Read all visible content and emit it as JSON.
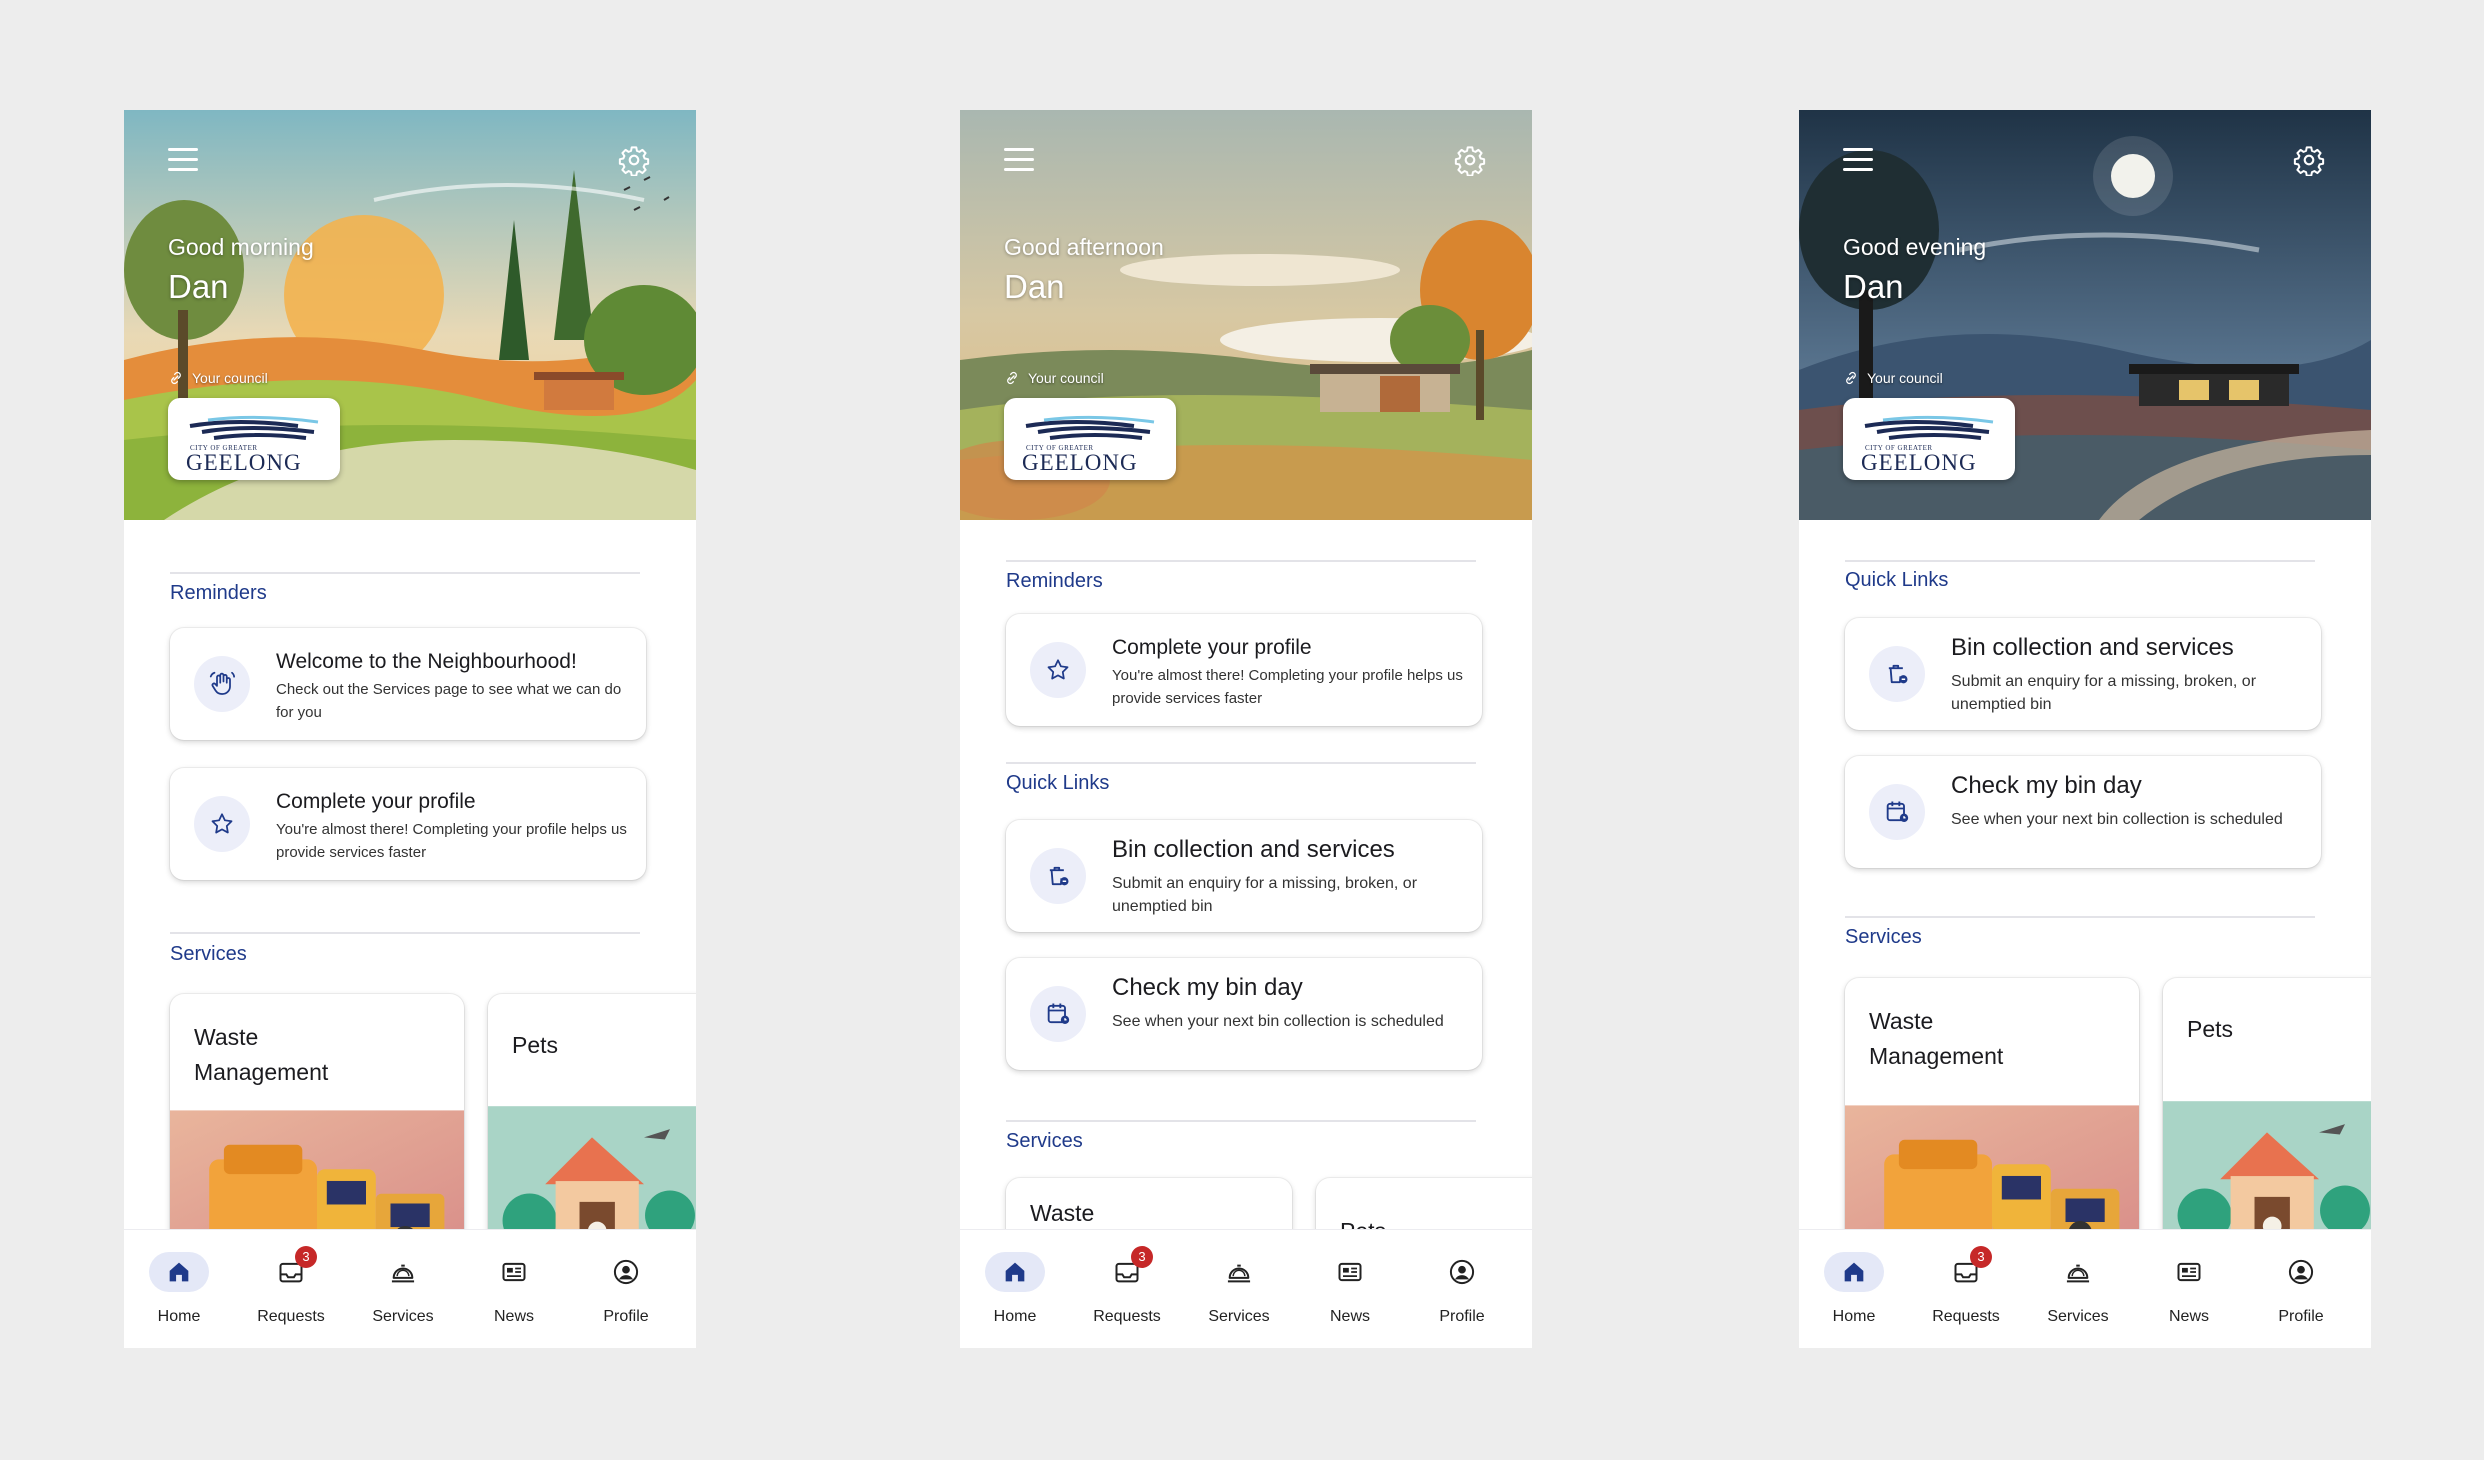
{
  "colors": {
    "accent": "#1f3a8a",
    "badge": "#c62828",
    "background": "#ededed"
  },
  "screens": [
    {
      "greeting": "Good morning",
      "name": "Dan",
      "council_label": "Your council",
      "logo_small": "CITY OF GREATER",
      "logo_word": "GEELONG",
      "reminders_title": "Reminders",
      "reminders": [
        {
          "icon": "waving-hand-icon",
          "title": "Welcome to the Neighbourhood!",
          "subtitle": "Check out the Services page to see what we can do for you"
        },
        {
          "icon": "star-icon",
          "title": "Complete your profile",
          "subtitle": "You're almost there! Completing your profile helps us provide services faster"
        }
      ],
      "services_title": "Services",
      "services": [
        "Waste Management",
        "Pets"
      ]
    },
    {
      "greeting": "Good afternoon",
      "name": "Dan",
      "council_label": "Your council",
      "logo_small": "CITY OF GREATER",
      "logo_word": "GEELONG",
      "reminders_title": "Reminders",
      "reminders": [
        {
          "icon": "star-icon",
          "title": "Complete your profile",
          "subtitle": "You're almost there! Completing your profile helps us provide services faster"
        }
      ],
      "quicklinks_title": "Quick Links",
      "quicklinks": [
        {
          "icon": "bin-icon",
          "title": "Bin collection and services",
          "subtitle": "Submit an enquiry for a missing, broken, or unemptied bin"
        },
        {
          "icon": "bin-calendar-icon",
          "title": "Check my bin day",
          "subtitle": "See when your next bin collection is scheduled"
        }
      ],
      "services_title": "Services",
      "services": [
        "Waste",
        "Pets"
      ]
    },
    {
      "greeting": "Good evening",
      "name": "Dan",
      "council_label": "Your council",
      "logo_small": "CITY OF GREATER",
      "logo_word": "GEELONG",
      "quicklinks_title": "Quick Links",
      "quicklinks": [
        {
          "icon": "bin-icon",
          "title": "Bin collection and services",
          "subtitle": "Submit an enquiry for a missing, broken, or unemptied bin"
        },
        {
          "icon": "bin-calendar-icon",
          "title": "Check my bin day",
          "subtitle": "See when your next bin collection is scheduled"
        }
      ],
      "services_title": "Services",
      "services": [
        "Waste Management",
        "Pets"
      ]
    }
  ],
  "nav": {
    "items": [
      {
        "label": "Home",
        "icon": "home-icon"
      },
      {
        "label": "Requests",
        "icon": "inbox-icon",
        "badge": "3"
      },
      {
        "label": "Services",
        "icon": "service-bell-icon"
      },
      {
        "label": "News",
        "icon": "newspaper-icon"
      },
      {
        "label": "Profile",
        "icon": "account-icon"
      }
    ]
  }
}
